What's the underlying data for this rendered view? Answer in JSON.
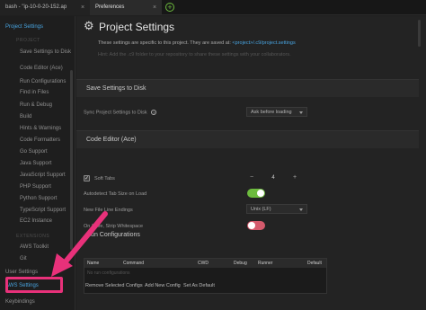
{
  "tabs": [
    {
      "label": "bash - \"ip-10-0-20-152.ap"
    },
    {
      "label": "Preferences"
    }
  ],
  "sidebar": {
    "project_settings": "Project Settings",
    "project_header": "PROJECT",
    "items": [
      "Save Settings to Disk",
      "Code Editor (Ace)",
      "Run Configurations",
      "Find in Files",
      "Run & Debug",
      "Build",
      "Hints & Warnings",
      "Code Formatters",
      "Go Support",
      "Java Support",
      "JavaScript Support",
      "PHP Support",
      "Python Support",
      "TypeScript Support",
      "EC2 Instance"
    ],
    "extensions_header": "EXTENSIONS",
    "ext_items": [
      "AWS Toolkit",
      "Git"
    ],
    "user_settings": "User Settings",
    "aws_settings": "AWS Settings",
    "keybindings": "Keybindings"
  },
  "main": {
    "title": "Project Settings",
    "desc_prefix": "These settings are specific to this project. They are saved at:",
    "desc_link": "<project>/.c9/project.settings",
    "hint": "Hint: Add the .c9 folder to your repository to share these settings with your collaborators.",
    "save_section": {
      "title": "Save Settings to Disk",
      "sync_label": "Sync Project Settings to Disk",
      "sync_value": "Ask before loading"
    },
    "editor_section": {
      "title": "Code Editor (Ace)",
      "soft_tabs_label": "Soft Tabs",
      "soft_tabs_value": "4",
      "autodetect_label": "Autodetect Tab Size on Load",
      "line_endings_label": "New File Line Endings",
      "line_endings_value": "Unix (LF)",
      "strip_label": "On Save, Strip Whitespace"
    },
    "run_section": {
      "title": "Run Configurations",
      "columns": [
        "Name",
        "Command",
        "CWD",
        "Debug",
        "Runner",
        "Default"
      ],
      "empty": "No run configurations",
      "actions": [
        "Remove Selected Configs",
        "Add New Config",
        "Set As Default"
      ]
    }
  },
  "colors": {
    "accent": "#48a4e0",
    "toggle_on": "#6dbb3e",
    "toggle_off": "#d45a6c",
    "annotation": "#e8317a"
  }
}
